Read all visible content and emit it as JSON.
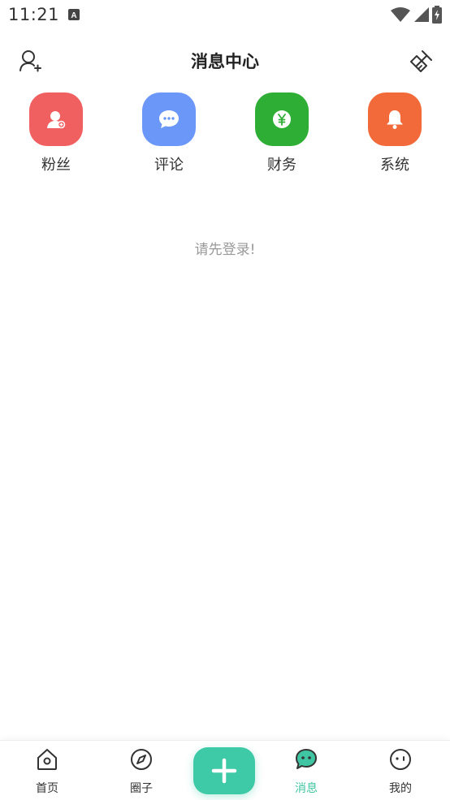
{
  "status_bar": {
    "time": "11:21"
  },
  "header": {
    "title": "消息中心"
  },
  "categories": [
    {
      "label": "粉丝",
      "icon": "fans-icon",
      "color": "#f06060"
    },
    {
      "label": "评论",
      "icon": "comment-icon",
      "color": "#6b98f8"
    },
    {
      "label": "财务",
      "icon": "finance-icon",
      "color": "#2fae35"
    },
    {
      "label": "系统",
      "icon": "bell-icon",
      "color": "#f26a3a"
    }
  ],
  "empty_message": "请先登录!",
  "bottom_nav": {
    "home": "首页",
    "circle": "圈子",
    "messages": "消息",
    "mine": "我的",
    "accent": "#3ecaa6"
  }
}
